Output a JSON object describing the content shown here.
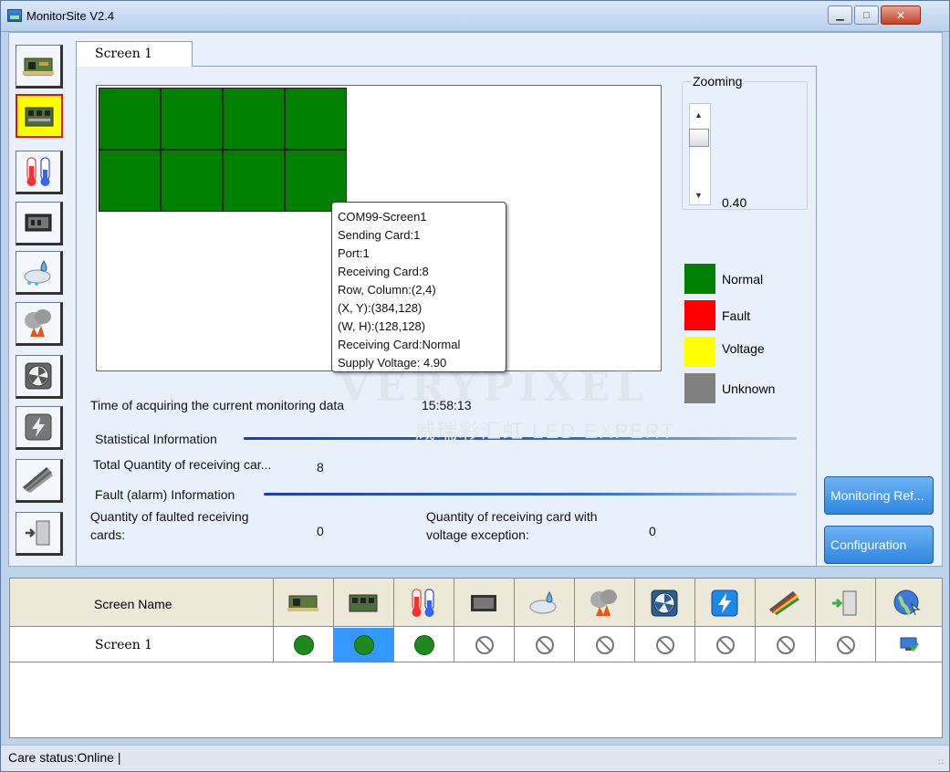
{
  "window": {
    "title": "MonitorSite V2.4",
    "minimize_icon": "minimize-icon",
    "maximize_icon": "maximize-icon",
    "close_icon": "close-icon"
  },
  "sidebar": {
    "items": [
      {
        "icon": "sending-card-icon",
        "active": false
      },
      {
        "icon": "receiving-card-icon",
        "active": true
      },
      {
        "icon": "temperature-icon",
        "active": false
      },
      {
        "icon": "module-icon",
        "active": false
      },
      {
        "icon": "humidity-icon",
        "active": false
      },
      {
        "icon": "smoke-icon",
        "active": false
      },
      {
        "icon": "fan-icon",
        "active": false
      },
      {
        "icon": "power-icon",
        "active": false
      },
      {
        "icon": "cable-icon",
        "active": false
      },
      {
        "icon": "door-icon",
        "active": false
      }
    ]
  },
  "tab": {
    "label": "Screen  1"
  },
  "screen_grid": {
    "rows": 2,
    "columns": 4,
    "cell_color": "#008000"
  },
  "tooltip": {
    "lines": [
      "COM99-Screen1",
      "Sending Card:1",
      "Port:1",
      "Receiving Card:8",
      "Row, Column:(2,4)",
      "(X, Y):(384,128)",
      "(W, H):(128,128)",
      "Receiving Card:Normal",
      "Supply Voltage: 4.90"
    ]
  },
  "zoom": {
    "legend": "Zooming",
    "value": "0.40"
  },
  "legend": [
    {
      "label": "Normal",
      "color": "#008000"
    },
    {
      "label": "Fault",
      "color": "#ff0000"
    },
    {
      "label": "Voltage",
      "color": "#ffff00"
    },
    {
      "label": "Unknown",
      "color": "#808080"
    }
  ],
  "watermark": {
    "main": "VERYPIXEL",
    "sub": "威瑞彩汇虹  LED  EXPERT"
  },
  "info": {
    "time_label": "Time of acquiring the current monitoring data",
    "time_value": "15:58:13",
    "stat_title": "Statistical Information",
    "total_label": "Total Quantity of receiving car...",
    "total_value": "8",
    "fault_title": "Fault (alarm) Information",
    "faulted_label_1": "Quantity of faulted receiving",
    "faulted_label_2": "cards:",
    "faulted_value": "0",
    "voltage_label_1": "Quantity of receiving card with",
    "voltage_label_2": "voltage exception:",
    "voltage_value": "0"
  },
  "buttons": {
    "monitoring_refresh": "Monitoring Ref...",
    "configuration": "Configuration"
  },
  "table": {
    "header_name": "Screen Name",
    "columns": [
      "sending-card-icon",
      "receiving-card-icon",
      "temperature-icon",
      "module-icon",
      "humidity-icon",
      "smoke-icon",
      "fan-icon",
      "power-icon",
      "cable-icon",
      "door-icon",
      "network-icon"
    ],
    "rows": [
      {
        "name": "Screen  1",
        "statuses": [
          "ok",
          "ok",
          "ok",
          "none",
          "none",
          "none",
          "none",
          "none",
          "none",
          "none",
          "online"
        ]
      }
    ]
  },
  "statusbar": {
    "text": "Care status:Online  |"
  }
}
